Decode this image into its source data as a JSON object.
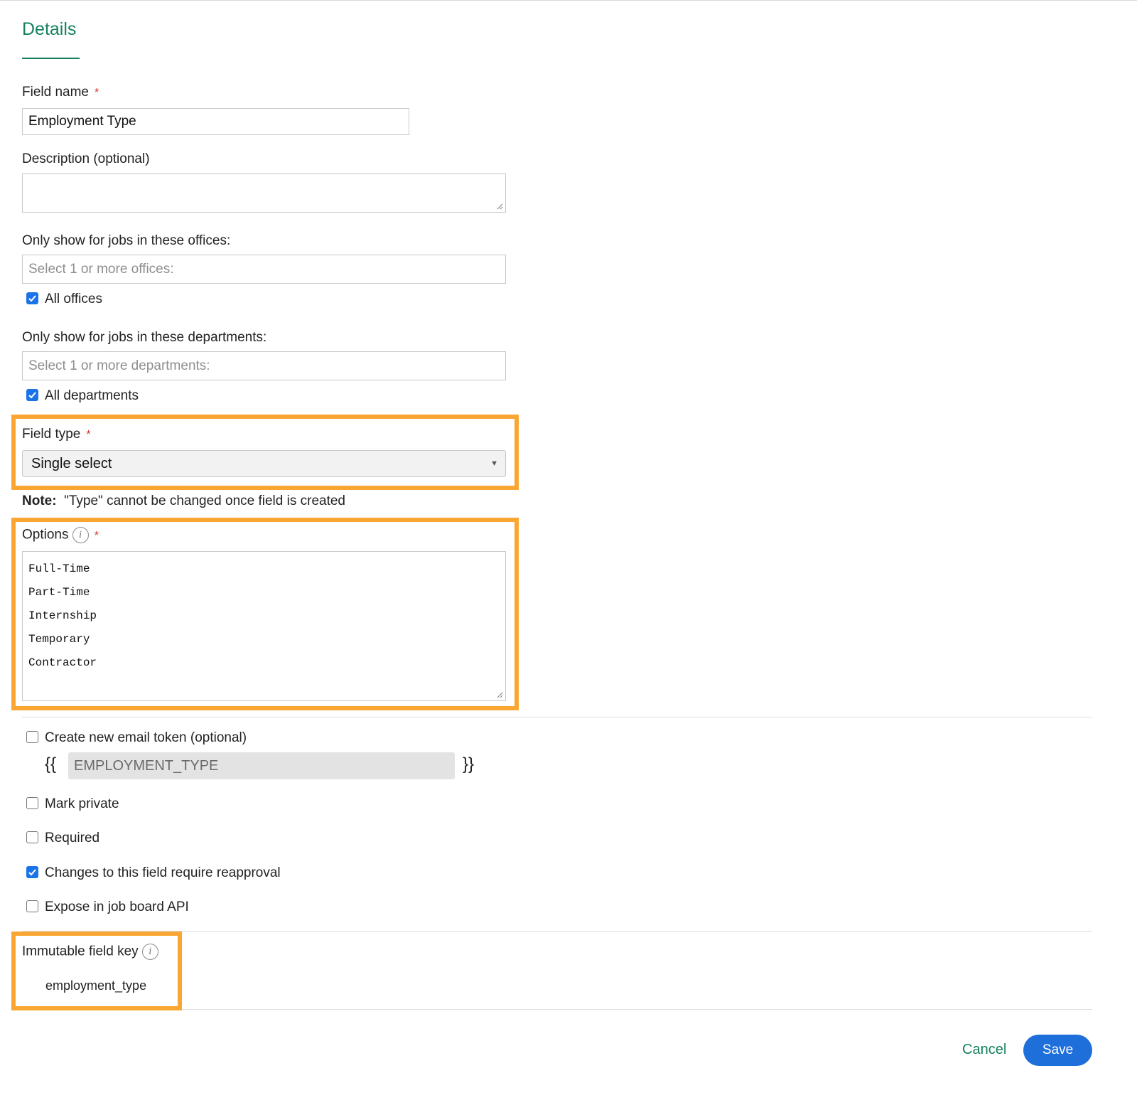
{
  "tab": {
    "title": "Details"
  },
  "field_name": {
    "label": "Field name",
    "required_mark": "*",
    "value": "Employment Type"
  },
  "description": {
    "label": "Description (optional)",
    "value": ""
  },
  "offices": {
    "label": "Only show for jobs in these offices:",
    "placeholder": "Select 1 or more offices:",
    "all_label": "All offices",
    "all_checked": true
  },
  "departments": {
    "label": "Only show for jobs in these departments:",
    "placeholder": "Select 1 or more departments:",
    "all_label": "All departments",
    "all_checked": true
  },
  "field_type": {
    "label": "Field type",
    "required_mark": "*",
    "value": "Single select",
    "arrow": "▼"
  },
  "note": {
    "bold": "Note:",
    "text": "\"Type\" cannot be changed once field is created"
  },
  "options": {
    "label": "Options",
    "info_glyph": "i",
    "required_mark": "*",
    "items": [
      "Full-Time",
      "Part-Time",
      "Internship",
      "Temporary",
      "Contractor"
    ]
  },
  "email_token": {
    "label": "Create new email token (optional)",
    "checked": false,
    "open_brace": "{{",
    "value": "EMPLOYMENT_TYPE",
    "close_brace": "}}"
  },
  "checkboxes": [
    {
      "label": "Mark private",
      "checked": false
    },
    {
      "label": "Required",
      "checked": false
    },
    {
      "label": "Changes to this field require reapproval",
      "checked": true
    },
    {
      "label": "Expose in job board API",
      "checked": false
    }
  ],
  "immutable_key": {
    "label": "Immutable field key",
    "info_glyph": "i",
    "value": "employment_type"
  },
  "actions": {
    "cancel_label": "Cancel",
    "save_label": "Save"
  },
  "colors": {
    "accent_green": "#15805f",
    "highlight_orange": "#f9a633",
    "primary_blue": "#1e6fd9",
    "required_red": "#d93025",
    "checkbox_blue": "#1a73e8"
  }
}
